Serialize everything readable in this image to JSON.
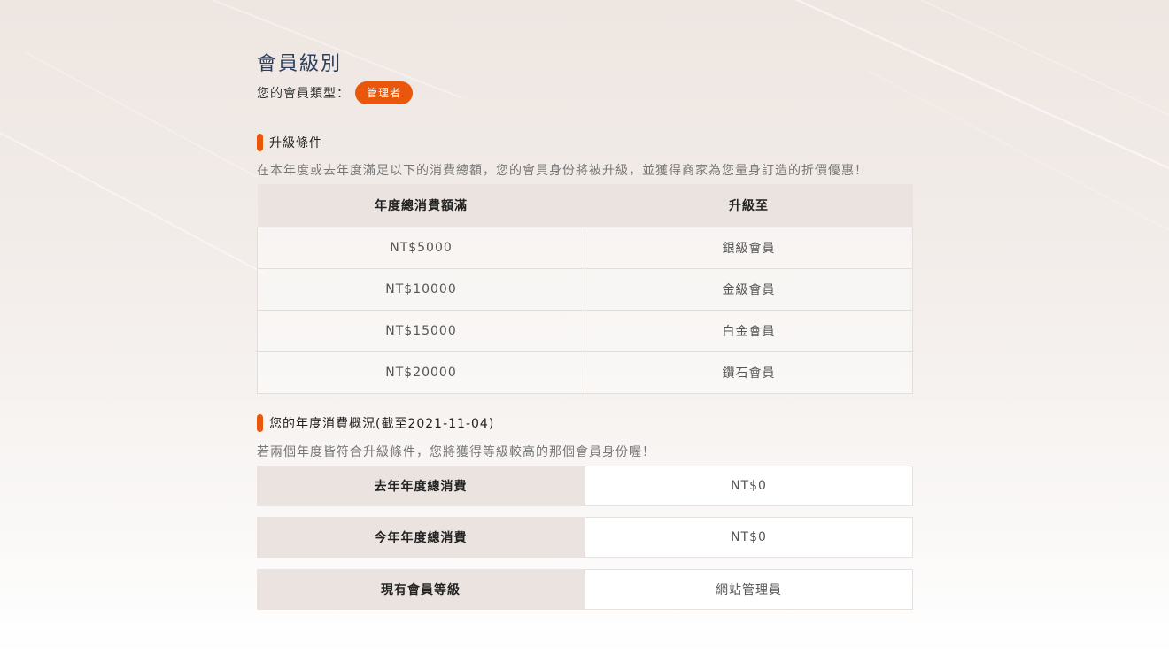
{
  "page": {
    "title": "會員級別",
    "member_type_label": "您的會員類型：",
    "member_type_badge": "管理者"
  },
  "upgrade": {
    "heading": "升級條件",
    "description": "在本年度或去年度滿足以下的消費總額，您的會員身份將被升級，並獲得商家為您量身訂造的折價優惠！",
    "columns": [
      "年度總消費額滿",
      "升級至"
    ],
    "rows": [
      [
        "NT$5000",
        "銀級會員"
      ],
      [
        "NT$10000",
        "金級會員"
      ],
      [
        "NT$15000",
        "白金會員"
      ],
      [
        "NT$20000",
        "鑽石會員"
      ]
    ]
  },
  "summary": {
    "heading": "您的年度消費概況(截至2021-11-04)",
    "description": "若兩個年度皆符合升級條件，您將獲得等級較高的那個會員身份喔！",
    "rows": [
      {
        "label": "去年年度總消費",
        "value": "NT$0"
      },
      {
        "label": "今年年度總消費",
        "value": "NT$0"
      },
      {
        "label": "現有會員等級",
        "value": "網站管理員"
      }
    ]
  },
  "colors": {
    "accent": "#e8570c",
    "title": "#2d3e5c",
    "header_bg": "#ebe3df"
  }
}
